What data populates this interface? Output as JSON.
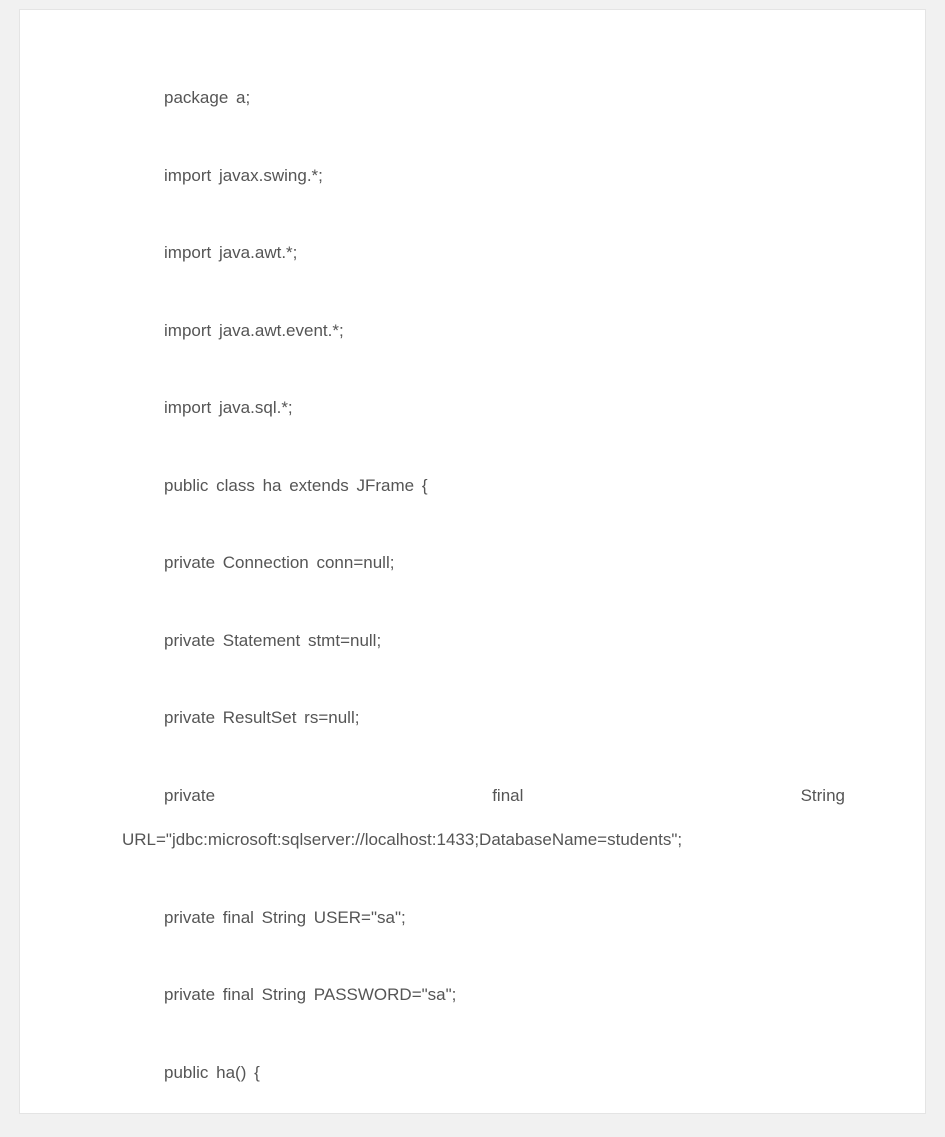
{
  "code_lines": [
    "package a;",
    "import javax.swing.*;",
    "import java.awt.*;",
    "import java.awt.event.*;",
    "import java.sql.*;",
    "public class ha extends JFrame {",
    "private Connection conn=null;",
    "private Statement stmt=null;",
    "private ResultSet rs=null;"
  ],
  "wrap_line": {
    "tokens": [
      "private",
      "final",
      "String"
    ],
    "continuation": "URL=\"jdbc:microsoft:sqlserver://localhost:1433;DatabaseName=students\";"
  },
  "code_lines_after": [
    "private final String USER=\"sa\";",
    "private final String PASSWORD=\"sa\";",
    "public ha() {"
  ]
}
